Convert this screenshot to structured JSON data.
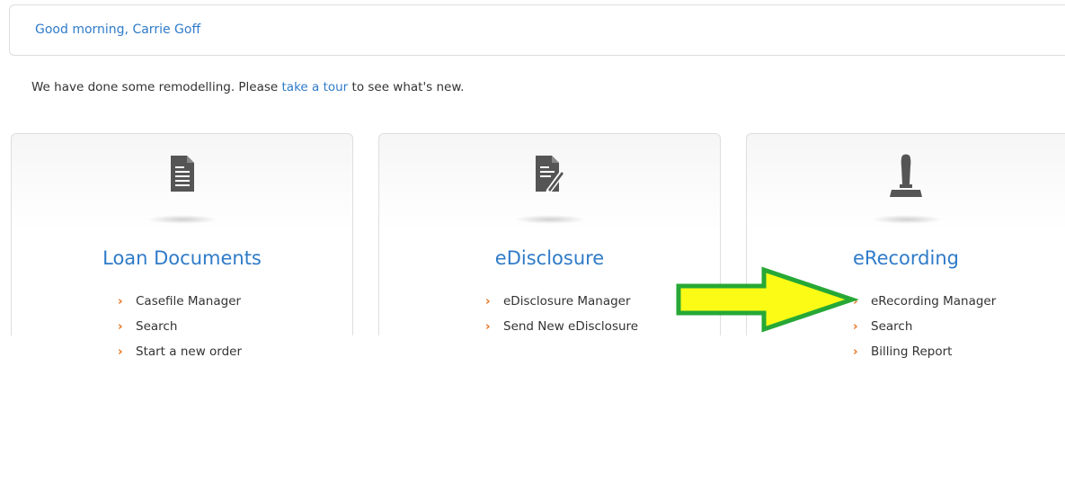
{
  "greeting": "Good morning, Carrie Goff",
  "intro": {
    "before": "We have done some remodelling. Please ",
    "link": "take a tour",
    "after": " to see what's new."
  },
  "cards": [
    {
      "title": "Loan Documents",
      "icon": "document-icon",
      "links": [
        "Casefile Manager",
        "Search",
        "Start a new order"
      ]
    },
    {
      "title": "eDisclosure",
      "icon": "document-pen-icon",
      "links": [
        "eDisclosure Manager",
        "Send New eDisclosure"
      ]
    },
    {
      "title": "eRecording",
      "icon": "stamp-icon",
      "links": [
        "eRecording Manager",
        "Search",
        "Billing Report"
      ]
    }
  ],
  "colors": {
    "link_blue": "#2f7bc8",
    "chevron_orange": "#e8721c",
    "arrow_fill": "#fbfb16",
    "arrow_stroke": "#27a836"
  }
}
